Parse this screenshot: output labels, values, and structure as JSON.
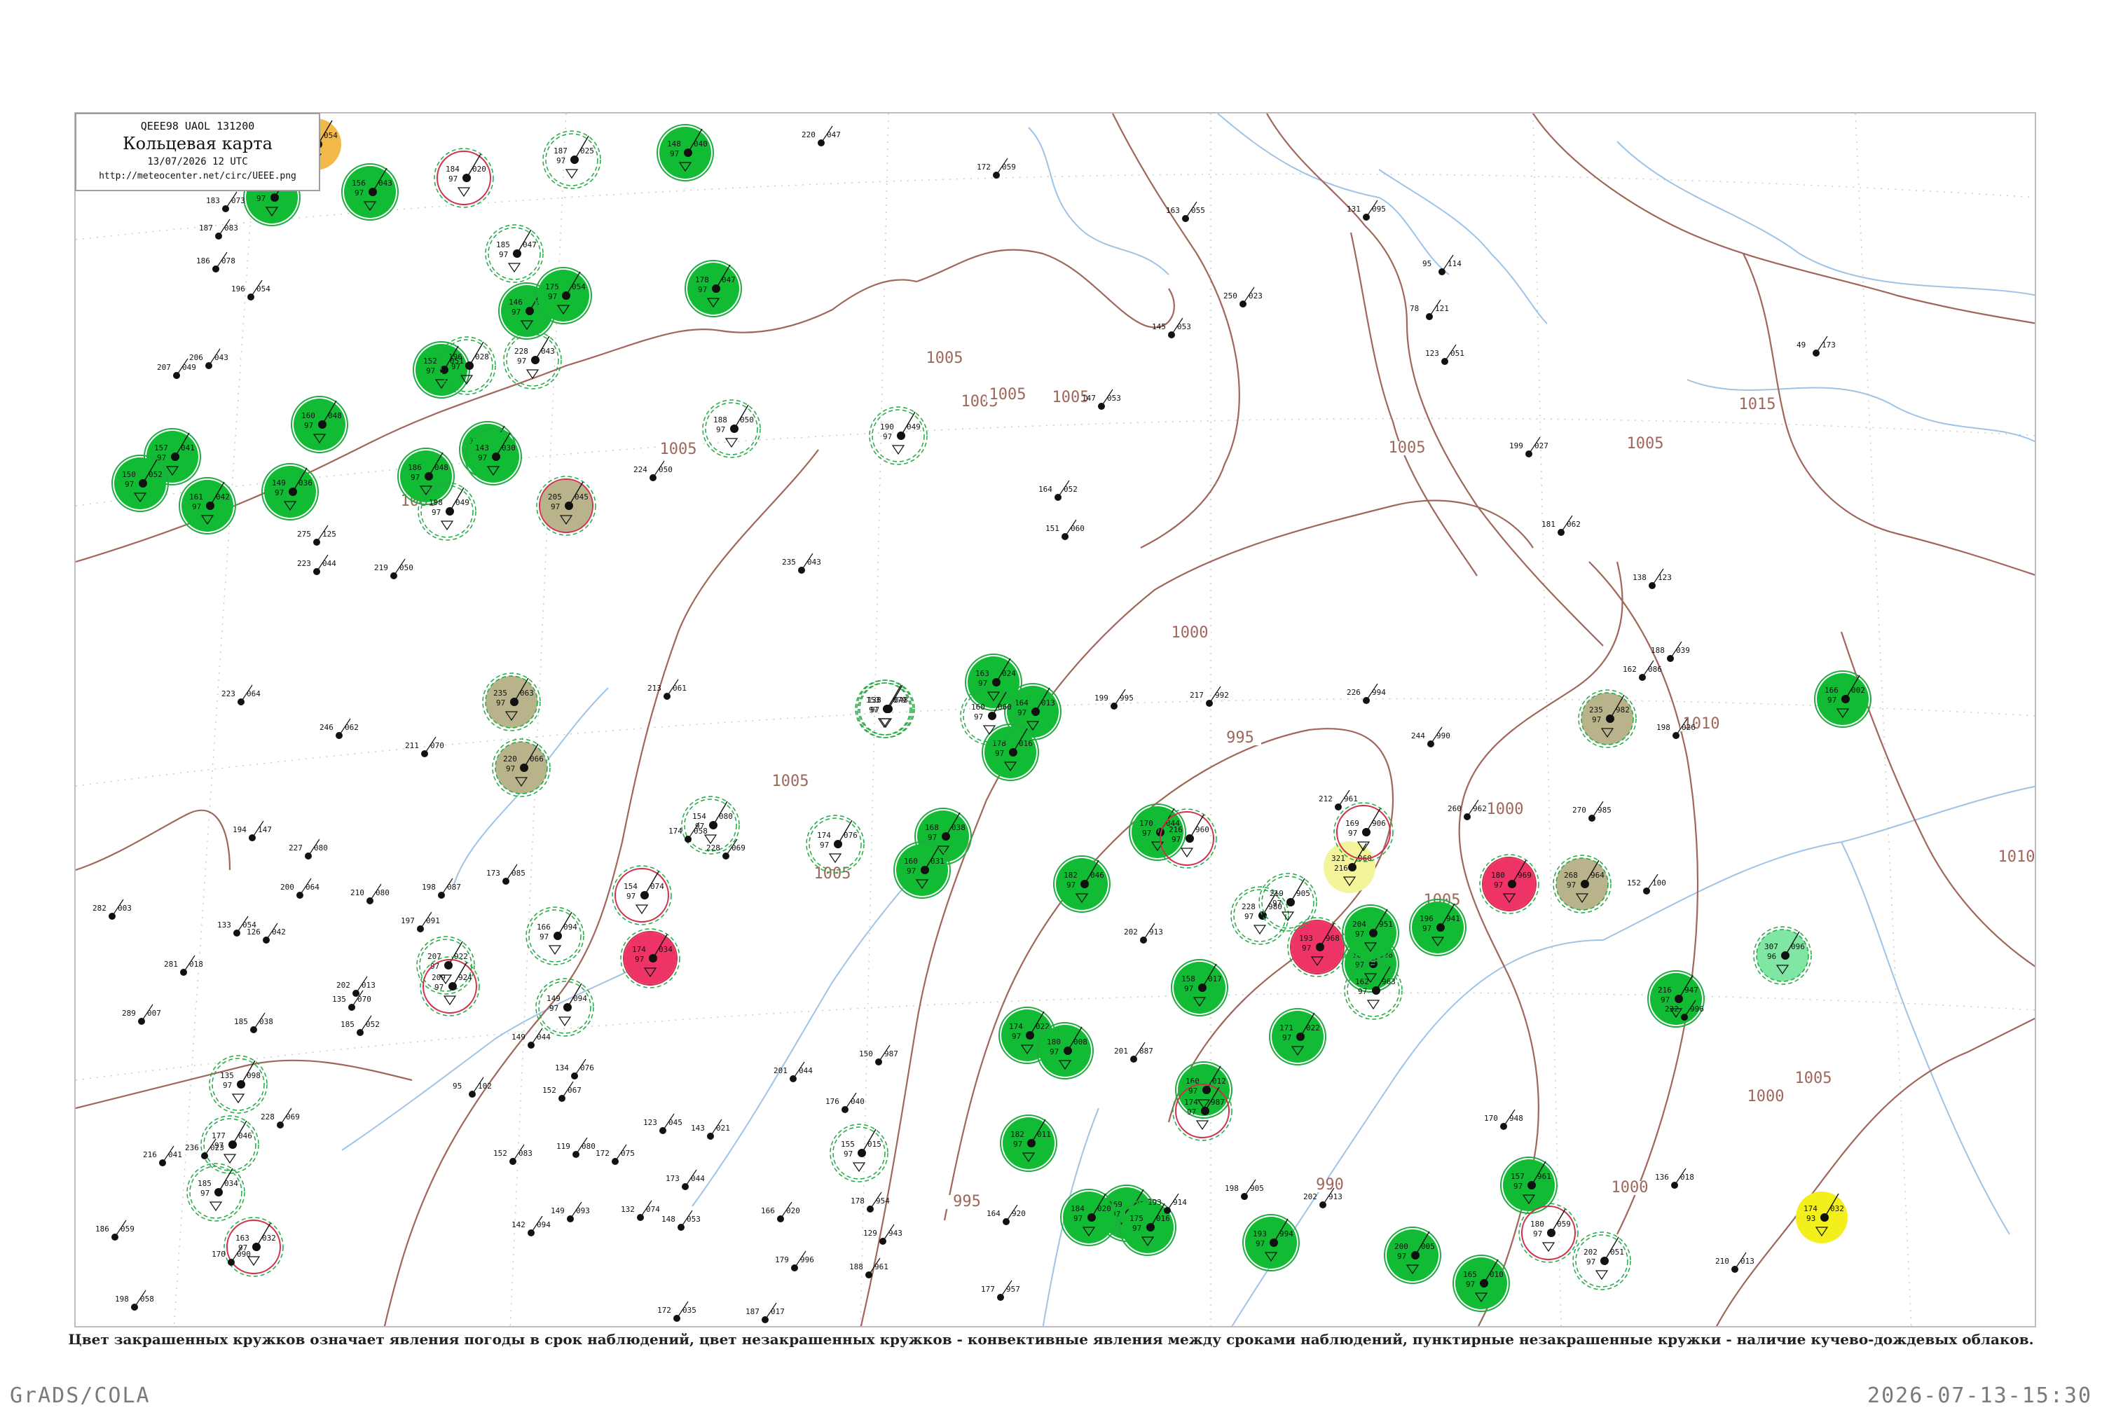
{
  "legend": {
    "code_line": "QEEE98  UAOL  131200",
    "title": "Кольцевая карта",
    "date": "13/07/2026 12 UTC",
    "url": "http://meteocenter.net/circ/UEEE.png"
  },
  "caption": "Цвет закрашенных кружков означает явления погоды в срок наблюдений, цвет незакрашенных кружков - конвективные явления между сроками наблюдений, пунктирные незакрашенные кружки - наличие кучево-дождевых облаков.",
  "footer": {
    "left": "GrADS/COLA",
    "right": "2026-07-13-15:30"
  },
  "colors": {
    "green": "#11bb33",
    "olive": "#b9b38c",
    "red": "#ee3366",
    "orange": "#f3b84a",
    "light_yellow": "#f4f49a",
    "yellow": "#f2ef1c",
    "mint": "#7fe6a3",
    "isobar": "#a0665a",
    "river": "#9fc3e6",
    "ring_green": "#22aa44",
    "ring_red": "#d0304c"
  },
  "isobars": [
    {
      "label": "1005"
    },
    {
      "label": "1005"
    },
    {
      "label": "1005"
    },
    {
      "label": "1005"
    },
    {
      "label": "1005"
    },
    {
      "label": "1005"
    },
    {
      "label": "1005"
    },
    {
      "label": "1005"
    },
    {
      "label": "1005"
    },
    {
      "label": "1005"
    },
    {
      "label": "1005"
    },
    {
      "label": "1005"
    },
    {
      "label": "1010"
    },
    {
      "label": "1010"
    },
    {
      "label": "1015"
    },
    {
      "label": "1000"
    },
    {
      "label": "1000"
    },
    {
      "label": "1000"
    },
    {
      "label": "1000"
    },
    {
      "label": "995"
    },
    {
      "label": "995"
    },
    {
      "label": "990"
    }
  ],
  "stations": [
    {
      "fill": "green",
      "ring": "solid-green",
      "t": "153",
      "p": "058",
      "d": "97"
    },
    {
      "fill": "green",
      "ring": "solid-green",
      "t": "156",
      "p": "043",
      "d": "97"
    },
    {
      "fill": "green",
      "ring": "solid-green",
      "t": "148",
      "p": "040",
      "d": "97"
    },
    {
      "fill": "green",
      "ring": "solid-green",
      "t": "157",
      "p": "041",
      "d": "97"
    },
    {
      "fill": "green",
      "ring": "solid-green",
      "t": "150",
      "p": "052",
      "d": "97"
    },
    {
      "fill": "green",
      "ring": "solid-green",
      "t": "161",
      "p": "042",
      "d": "97"
    },
    {
      "fill": "green",
      "ring": "solid-green",
      "t": "149",
      "p": "036",
      "d": "97"
    },
    {
      "fill": "green",
      "ring": "solid-green",
      "t": "160",
      "p": "048",
      "d": "97"
    },
    {
      "fill": "green",
      "ring": "solid-green",
      "t": "146",
      "p": "045",
      "d": "97"
    },
    {
      "fill": "green",
      "ring": "solid-green",
      "t": "175",
      "p": "054",
      "d": "97"
    },
    {
      "fill": "green",
      "ring": "solid-green",
      "t": "152",
      "p": "051",
      "d": "97"
    },
    {
      "fill": "green",
      "ring": "solid-green",
      "t": "154",
      "p": "033",
      "d": "97"
    },
    {
      "fill": "green",
      "ring": "solid-green",
      "t": "143",
      "p": "030",
      "d": "97"
    },
    {
      "fill": "green",
      "ring": "solid-green",
      "t": "186",
      "p": "048",
      "d": "97"
    },
    {
      "fill": "green",
      "ring": "solid-green",
      "t": "178",
      "p": "047",
      "d": "97"
    },
    {
      "fill": "olive",
      "ring": "solid-red",
      "t": "205",
      "p": "045",
      "d": "97"
    },
    {
      "fill": "olive",
      "ring": "dashed-green",
      "t": "220",
      "p": "066",
      "d": "97"
    },
    {
      "fill": "olive",
      "ring": "dashed-green",
      "t": "235",
      "p": "063",
      "d": "97"
    },
    {
      "fill": "green",
      "ring": "solid-green",
      "t": "168",
      "p": "038",
      "d": "97"
    },
    {
      "fill": "green",
      "ring": "solid-green",
      "t": "160",
      "p": "031",
      "d": "97"
    },
    {
      "fill": "green",
      "ring": "solid-green",
      "t": "164",
      "p": "013",
      "d": "97"
    },
    {
      "fill": "green",
      "ring": "solid-green",
      "t": "163",
      "p": "024",
      "d": "97"
    },
    {
      "fill": "green",
      "ring": "solid-green",
      "t": "178",
      "p": "016",
      "d": "97"
    },
    {
      "fill": "red",
      "ring": "solid-red",
      "t": "174",
      "p": "034",
      "d": "97"
    },
    {
      "fill": "green",
      "ring": "solid-green",
      "t": "182",
      "p": "046",
      "d": "97"
    },
    {
      "fill": "green",
      "ring": "solid-green",
      "t": "170",
      "p": "044",
      "d": "97"
    },
    {
      "fill": "green",
      "ring": "solid-green",
      "t": "174",
      "p": "022",
      "d": "97"
    },
    {
      "fill": "green",
      "ring": "solid-green",
      "t": "180",
      "p": "008",
      "d": "97"
    },
    {
      "fill": "green",
      "ring": "solid-green",
      "t": "160",
      "p": "012",
      "d": "97"
    },
    {
      "fill": "green",
      "ring": "solid-green",
      "t": "158",
      "p": "017",
      "d": "97"
    },
    {
      "fill": "green",
      "ring": "solid-green",
      "t": "186",
      "p": "026",
      "d": "97"
    },
    {
      "fill": "green",
      "ring": "solid-green",
      "t": "171",
      "p": "022",
      "d": "97"
    },
    {
      "fill": "green",
      "ring": "solid-green",
      "t": "169",
      "p": "035",
      "d": "97"
    },
    {
      "fill": "green",
      "ring": "solid-green",
      "t": "182",
      "p": "011",
      "d": "97"
    },
    {
      "fill": "green",
      "ring": "solid-green",
      "t": "184",
      "p": "020",
      "d": "97"
    },
    {
      "fill": "green",
      "ring": "solid-green",
      "t": "175",
      "p": "016",
      "d": "97"
    },
    {
      "fill": "green",
      "ring": "solid-green",
      "t": "200",
      "p": "005",
      "d": "97"
    },
    {
      "fill": "green",
      "ring": "solid-green",
      "t": "193",
      "p": "994",
      "d": "97"
    },
    {
      "fill": "green",
      "ring": "solid-green",
      "t": "165",
      "p": "010",
      "d": "97"
    },
    {
      "fill": "red",
      "ring": "solid-red",
      "t": "180",
      "p": "969",
      "d": "97"
    },
    {
      "fill": "red",
      "ring": "solid-red",
      "t": "193",
      "p": "968",
      "d": "97"
    },
    {
      "fill": "light_yellow",
      "ring": "none",
      "t": "321",
      "p": "060",
      "d": "216"
    },
    {
      "fill": "olive",
      "ring": "dashed-green",
      "t": "235",
      "p": "982",
      "d": "97"
    },
    {
      "fill": "olive",
      "ring": "dashed-green",
      "t": "268",
      "p": "964",
      "d": "97"
    },
    {
      "fill": "green",
      "ring": "solid-green",
      "t": "204",
      "p": "951",
      "d": "97"
    },
    {
      "fill": "green",
      "ring": "solid-green",
      "t": "196",
      "p": "941",
      "d": "97"
    },
    {
      "fill": "green",
      "ring": "solid-green",
      "t": "166",
      "p": "002",
      "d": "97"
    },
    {
      "fill": "green",
      "ring": "solid-green",
      "t": "216",
      "p": "947",
      "d": "97"
    },
    {
      "fill": "green",
      "ring": "solid-green",
      "t": "157",
      "p": "961",
      "d": "97"
    },
    {
      "fill": "mint",
      "ring": "dashed-green",
      "t": "307",
      "p": "096",
      "d": "96"
    },
    {
      "fill": "yellow",
      "ring": "none",
      "t": "174",
      "p": "032",
      "d": "93"
    },
    {
      "fill": "orange",
      "ring": "none",
      "t": "208",
      "p": "054",
      "d": "97"
    },
    {
      "fill": "none",
      "ring": "solid-red",
      "t": "184",
      "p": "020",
      "d": "97"
    },
    {
      "fill": "none",
      "ring": "dashed-green",
      "t": "187",
      "p": "025",
      "d": "97"
    },
    {
      "fill": "none",
      "ring": "dashed-green",
      "t": "185",
      "p": "047",
      "d": "97"
    },
    {
      "fill": "none",
      "ring": "dashed-green",
      "t": "196",
      "p": "028",
      "d": "97"
    },
    {
      "fill": "none",
      "ring": "dashed-green",
      "t": "228",
      "p": "043",
      "d": "97"
    },
    {
      "fill": "none",
      "ring": "dashed-green",
      "t": "188",
      "p": "050",
      "d": "97"
    },
    {
      "fill": "none",
      "ring": "dashed-green",
      "t": "198",
      "p": "049",
      "d": "97"
    },
    {
      "fill": "none",
      "ring": "dashed-green",
      "t": "190",
      "p": "049",
      "d": "97"
    },
    {
      "fill": "none",
      "ring": "dashed-green",
      "t": "138",
      "p": "048",
      "d": "97"
    },
    {
      "fill": "none",
      "ring": "dashed-green",
      "t": "153",
      "p": "079",
      "d": "97"
    },
    {
      "fill": "none",
      "ring": "dashed-green",
      "t": "160",
      "p": "060",
      "d": "97"
    },
    {
      "fill": "none",
      "ring": "dashed-green",
      "t": "174",
      "p": "076",
      "d": "97"
    },
    {
      "fill": "none",
      "ring": "dashed-green",
      "t": "154",
      "p": "080",
      "d": "97"
    },
    {
      "fill": "none",
      "ring": "solid-red",
      "t": "154",
      "p": "074",
      "d": "97"
    },
    {
      "fill": "none",
      "ring": "dashed-green",
      "t": "166",
      "p": "094",
      "d": "97"
    },
    {
      "fill": "none",
      "ring": "dashed-green",
      "t": "149",
      "p": "094",
      "d": "97"
    },
    {
      "fill": "none",
      "ring": "dashed-green",
      "t": "207",
      "p": "922",
      "d": "97"
    },
    {
      "fill": "none",
      "ring": "solid-red",
      "t": "209",
      "p": "924",
      "d": "97"
    },
    {
      "fill": "none",
      "ring": "solid-red",
      "t": "216",
      "p": "960",
      "d": "97"
    },
    {
      "fill": "none",
      "ring": "dashed-green",
      "t": "228",
      "p": "980",
      "d": "97"
    },
    {
      "fill": "none",
      "ring": "dashed-green",
      "t": "219",
      "p": "905",
      "d": "97"
    },
    {
      "fill": "none",
      "ring": "solid-red",
      "t": "169",
      "p": "906",
      "d": "97"
    },
    {
      "fill": "none",
      "ring": "dashed-green",
      "t": "162",
      "p": "963",
      "d": "97"
    },
    {
      "fill": "none",
      "ring": "solid-red",
      "t": "174",
      "p": "987",
      "d": "97"
    },
    {
      "fill": "none",
      "ring": "solid-red",
      "t": "180",
      "p": "059",
      "d": "97"
    },
    {
      "fill": "none",
      "ring": "dashed-green",
      "t": "202",
      "p": "051",
      "d": "97"
    },
    {
      "fill": "none",
      "ring": "solid-red",
      "t": "163",
      "p": "032",
      "d": "97"
    },
    {
      "fill": "none",
      "ring": "dashed-green",
      "t": "177",
      "p": "046",
      "d": "97"
    },
    {
      "fill": "none",
      "ring": "dashed-green",
      "t": "185",
      "p": "034",
      "d": "97"
    },
    {
      "fill": "none",
      "ring": "dashed-green",
      "t": "135",
      "p": "098",
      "d": "97"
    },
    {
      "fill": "none",
      "ring": "dashed-green",
      "t": "155",
      "p": "015",
      "d": "97"
    }
  ],
  "plain_stations": [
    {
      "t": "183",
      "p": "073"
    },
    {
      "t": "187",
      "p": "083"
    },
    {
      "t": "186",
      "p": "078"
    },
    {
      "t": "196",
      "p": "054"
    },
    {
      "t": "207",
      "p": "049"
    },
    {
      "t": "206",
      "p": "043"
    },
    {
      "t": "220",
      "p": "047"
    },
    {
      "t": "172",
      "p": "059"
    },
    {
      "t": "163",
      "p": "055"
    },
    {
      "t": "131",
      "p": "095"
    },
    {
      "t": "95",
      "p": "114"
    },
    {
      "t": "78",
      "p": "121"
    },
    {
      "t": "145",
      "p": "053"
    },
    {
      "t": "250",
      "p": "023"
    },
    {
      "t": "123",
      "p": "051"
    },
    {
      "t": "49",
      "p": "173"
    },
    {
      "t": "147",
      "p": "053"
    },
    {
      "t": "164",
      "p": "052"
    },
    {
      "t": "151",
      "p": "060"
    },
    {
      "t": "199",
      "p": "027"
    },
    {
      "t": "181",
      "p": "062"
    },
    {
      "t": "235",
      "p": "043"
    },
    {
      "t": "224",
      "p": "050"
    },
    {
      "t": "223",
      "p": "044"
    },
    {
      "t": "138",
      "p": "123"
    },
    {
      "t": "188",
      "p": "039"
    },
    {
      "t": "162",
      "p": "086"
    },
    {
      "t": "213",
      "p": "061"
    },
    {
      "t": "199",
      "p": "995"
    },
    {
      "t": "217",
      "p": "992"
    },
    {
      "t": "226",
      "p": "994"
    },
    {
      "t": "244",
      "p": "990"
    },
    {
      "t": "198",
      "p": "026"
    },
    {
      "t": "212",
      "p": "961"
    },
    {
      "t": "260",
      "p": "962"
    },
    {
      "t": "270",
      "p": "985"
    },
    {
      "t": "152",
      "p": "100"
    },
    {
      "t": "202",
      "p": "913"
    },
    {
      "t": "201",
      "p": "887"
    },
    {
      "t": "232",
      "p": "996"
    },
    {
      "t": "170",
      "p": "948"
    },
    {
      "t": "136",
      "p": "018"
    },
    {
      "t": "210",
      "p": "013"
    },
    {
      "t": "177",
      "p": "957"
    },
    {
      "t": "172",
      "p": "035"
    },
    {
      "t": "187",
      "p": "017"
    },
    {
      "t": "216",
      "p": "041"
    },
    {
      "t": "186",
      "p": "059"
    },
    {
      "t": "198",
      "p": "058"
    },
    {
      "t": "170",
      "p": "090"
    },
    {
      "t": "236",
      "p": "023"
    },
    {
      "t": "289",
      "p": "007"
    },
    {
      "t": "185",
      "p": "038"
    },
    {
      "t": "281",
      "p": "018"
    },
    {
      "t": "282",
      "p": "003"
    },
    {
      "t": "200",
      "p": "064"
    },
    {
      "t": "210",
      "p": "080"
    },
    {
      "t": "198",
      "p": "087"
    },
    {
      "t": "197",
      "p": "091"
    },
    {
      "t": "173",
      "p": "085"
    },
    {
      "t": "174",
      "p": "058"
    },
    {
      "t": "228",
      "p": "069"
    },
    {
      "t": "227",
      "p": "080"
    },
    {
      "t": "194",
      "p": "147"
    },
    {
      "t": "275",
      "p": "125"
    },
    {
      "t": "219",
      "p": "050"
    },
    {
      "t": "223",
      "p": "064"
    },
    {
      "t": "246",
      "p": "062"
    },
    {
      "t": "211",
      "p": "070"
    },
    {
      "t": "202",
      "p": "013"
    },
    {
      "t": "193",
      "p": "914"
    },
    {
      "t": "198",
      "p": "905"
    },
    {
      "t": "202",
      "p": "913"
    },
    {
      "t": "164",
      "p": "920"
    },
    {
      "t": "150",
      "p": "987"
    },
    {
      "t": "166",
      "p": "020"
    },
    {
      "t": "179",
      "p": "996"
    },
    {
      "t": "178",
      "p": "954"
    },
    {
      "t": "188",
      "p": "961"
    },
    {
      "t": "129",
      "p": "943"
    },
    {
      "t": "143",
      "p": "021"
    },
    {
      "t": "123",
      "p": "045"
    },
    {
      "t": "173",
      "p": "044"
    },
    {
      "t": "148",
      "p": "053"
    },
    {
      "t": "132",
      "p": "074"
    },
    {
      "t": "172",
      "p": "075"
    },
    {
      "t": "119",
      "p": "080"
    },
    {
      "t": "152",
      "p": "083"
    },
    {
      "t": "142",
      "p": "094"
    },
    {
      "t": "149",
      "p": "093"
    },
    {
      "t": "152",
      "p": "067"
    },
    {
      "t": "134",
      "p": "076"
    },
    {
      "t": "95",
      "p": "102"
    },
    {
      "t": "149",
      "p": "044"
    },
    {
      "t": "135",
      "p": "070"
    },
    {
      "t": "185",
      "p": "052"
    },
    {
      "t": "201",
      "p": "044"
    },
    {
      "t": "176",
      "p": "040"
    },
    {
      "t": "228",
      "p": "069"
    },
    {
      "t": "133",
      "p": "054"
    },
    {
      "t": "126",
      "p": "042"
    }
  ]
}
